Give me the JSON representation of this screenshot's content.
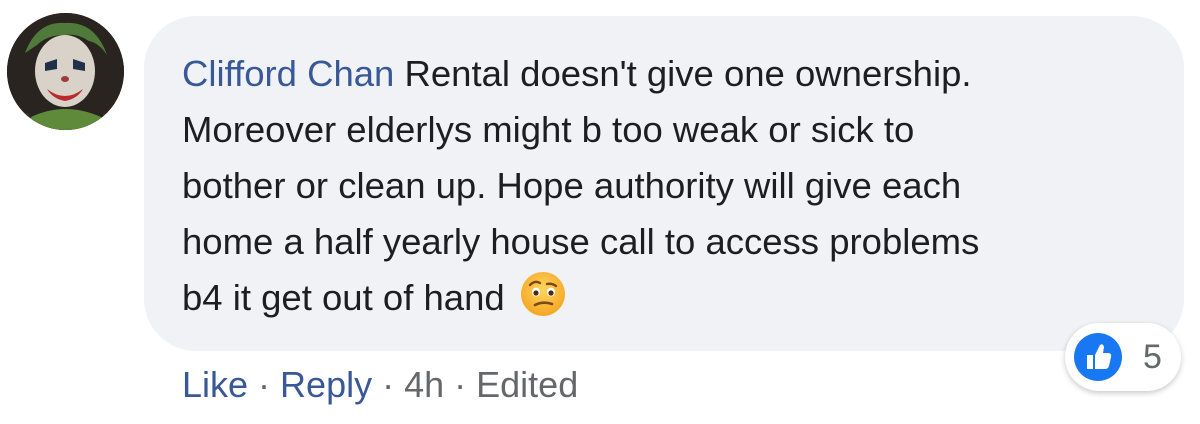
{
  "comment": {
    "author": "Clifford Chan",
    "lines": [
      "Rental doesn't give one ownership.",
      "Moreover elderlys might b too weak or sick to",
      "bother or clean up. Hope authority will give each",
      "home a half yearly house call to access problems",
      "b4 it get out of hand"
    ],
    "emoji": "face-with-raised-eyebrow-icon"
  },
  "reactions": {
    "type": "like",
    "count": "5",
    "badge_color": "#1877f2"
  },
  "actions": {
    "like": "Like",
    "reply": "Reply",
    "time": "4h",
    "edited": "Edited",
    "separator": "·"
  },
  "colors": {
    "bubble": "#f0f2f5",
    "author": "#385898",
    "text": "#1c1e21",
    "meta": "#65676b"
  }
}
